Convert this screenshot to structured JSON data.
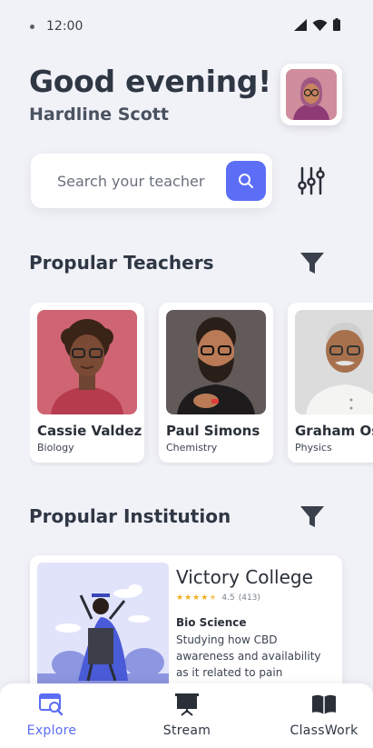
{
  "status_bar": {
    "time": "12:00"
  },
  "header": {
    "greeting": "Good evening!",
    "user_name": "Hardline Scott"
  },
  "search": {
    "placeholder": "Search your teacher"
  },
  "teachers_section": {
    "title": "Propular Teachers",
    "teachers": [
      {
        "name": "Cassie Valdez",
        "subject": "Biology"
      },
      {
        "name": "Paul Simons",
        "subject": "Chemistry"
      },
      {
        "name": "Graham Osborn",
        "subject": "Physics"
      }
    ]
  },
  "institution_section": {
    "title": "Propular Institution",
    "institution": {
      "name": "Victory College",
      "rating": "4.5",
      "reviews": "(413)",
      "field": "Bio Science",
      "description": "Studying how CBD awareness and availability as it related to pain management alternatives."
    }
  },
  "bottom_nav": {
    "items": [
      {
        "label": "Explore",
        "active": true
      },
      {
        "label": "Stream",
        "active": false
      },
      {
        "label": "ClassWork",
        "active": false
      }
    ]
  },
  "colors": {
    "accent": "#5b6ef5",
    "background": "#f1f2f8",
    "star": "#f2b01e"
  }
}
